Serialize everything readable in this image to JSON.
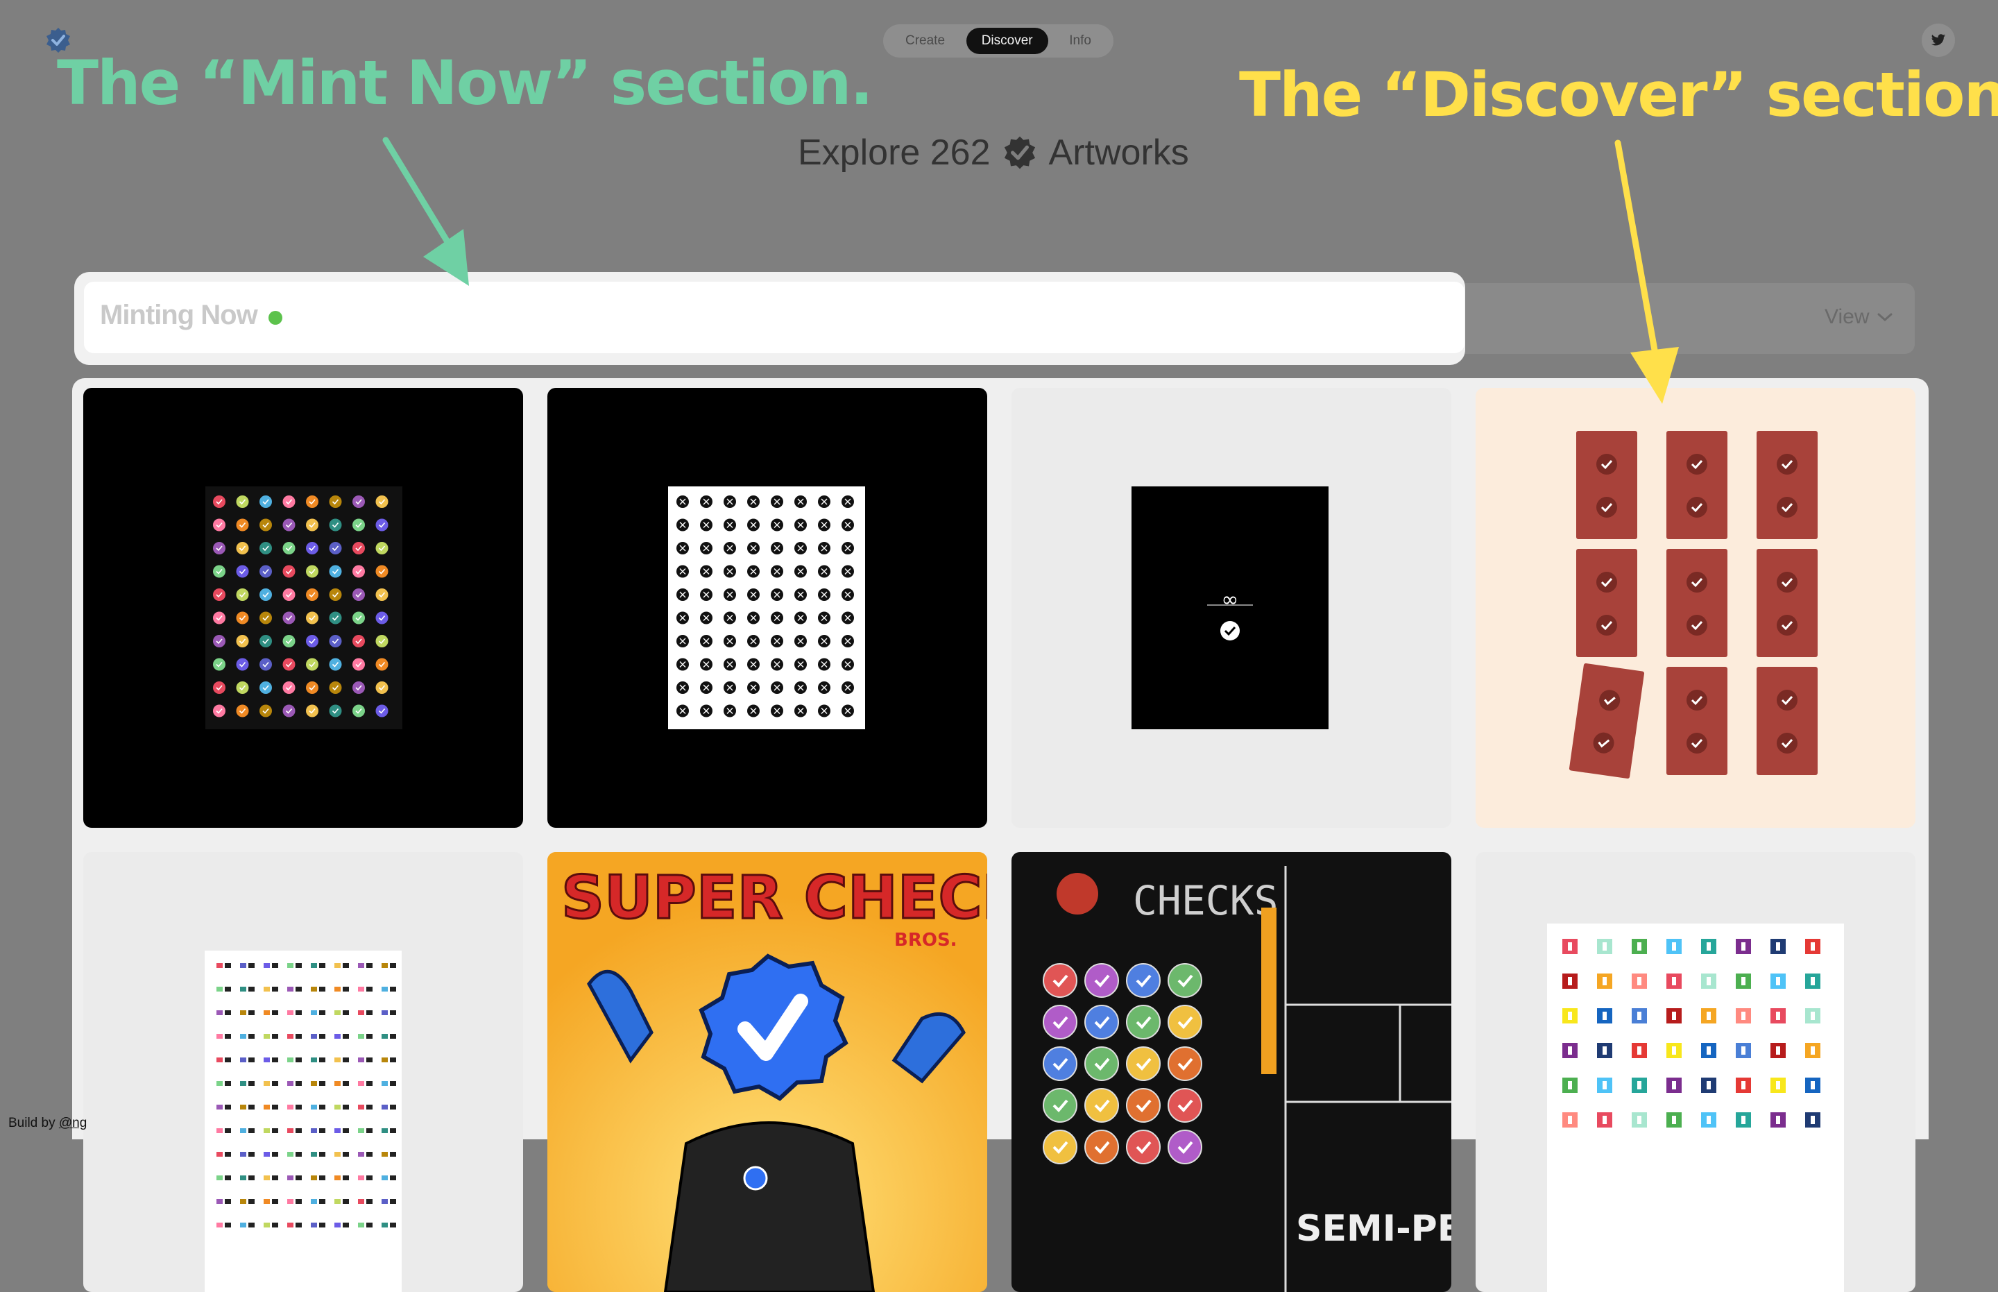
{
  "app": {
    "logo_icon": "verified-check-icon",
    "twitter_icon": "twitter-bird-icon"
  },
  "nav": {
    "tabs": [
      {
        "label": "Create",
        "active": false
      },
      {
        "label": "Discover",
        "active": true
      },
      {
        "label": "Info",
        "active": false
      }
    ]
  },
  "annotations": {
    "mint": "The “Mint Now” section.",
    "discover": "The “Discover” section.",
    "mint_color": "#6fd0a4",
    "discover_color": "#ffe04a"
  },
  "explore": {
    "prefix": "Explore 262",
    "suffix": "Artworks",
    "icon": "verified-check-icon"
  },
  "minting": {
    "label": "Minting Now",
    "status_color": "#5cc24c",
    "view_label": "View",
    "view_icon": "chevron-down-icon"
  },
  "grid": {
    "tiles": [
      {
        "name": "Colorful checks grid on black"
      },
      {
        "name": "Black checks grid on white"
      },
      {
        "name": "Infinity single check"
      },
      {
        "name": "Red brick checks"
      },
      {
        "name": "Colored eyes grid"
      },
      {
        "name": "Super Check Bros",
        "text": "SUPER CHECK",
        "subtext": "BROS."
      },
      {
        "name": "Checks chalkboard",
        "text": "CHECKS",
        "subtext": "SEMI-PERFECT"
      },
      {
        "name": "Colored squares grid"
      }
    ]
  },
  "credit": {
    "prefix": "Build by ",
    "handle": "@ng"
  }
}
